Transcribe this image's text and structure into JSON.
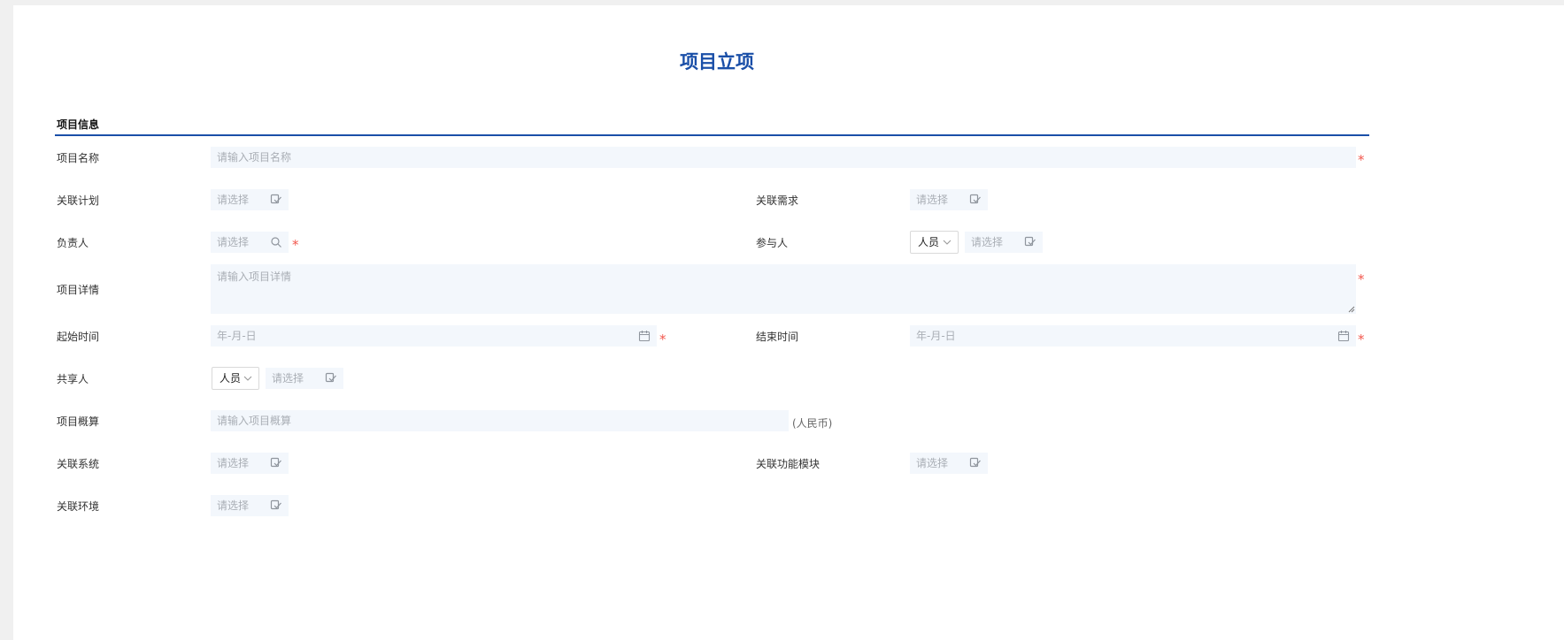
{
  "page": {
    "title": "项目立项"
  },
  "section": {
    "title": "项目信息"
  },
  "fields": {
    "name": {
      "label": "项目名称",
      "placeholder": "请输入项目名称"
    },
    "plan": {
      "label": "关联计划",
      "placeholder": "请选择"
    },
    "demand": {
      "label": "关联需求",
      "placeholder": "请选择"
    },
    "owner": {
      "label": "负责人",
      "placeholder": "请选择"
    },
    "participants": {
      "label": "参与人",
      "type_value": "人员",
      "placeholder": "请选择"
    },
    "detail": {
      "label": "项目详情",
      "placeholder": "请输入项目详情"
    },
    "start": {
      "label": "起始时间",
      "placeholder": "年-月-日"
    },
    "end": {
      "label": "结束时间",
      "placeholder": "年-月-日"
    },
    "sharer": {
      "label": "共享人",
      "type_value": "人员",
      "placeholder": "请选择"
    },
    "budget": {
      "label": "项目概算",
      "placeholder": "请输入项目概算",
      "unit": "(人民币)"
    },
    "system": {
      "label": "关联系统",
      "placeholder": "请选择"
    },
    "module": {
      "label": "关联功能模块",
      "placeholder": "请选择"
    },
    "env": {
      "label": "关联环境",
      "placeholder": "请选择"
    }
  },
  "required_mark": "*",
  "colors": {
    "accent": "#1a4fa8",
    "required": "#f2574d",
    "field_bg": "#f3f7fc"
  },
  "icons": {
    "select": "checklist-icon",
    "search": "search-icon",
    "date": "calendar-icon",
    "dropdown": "chevron-down-icon"
  }
}
